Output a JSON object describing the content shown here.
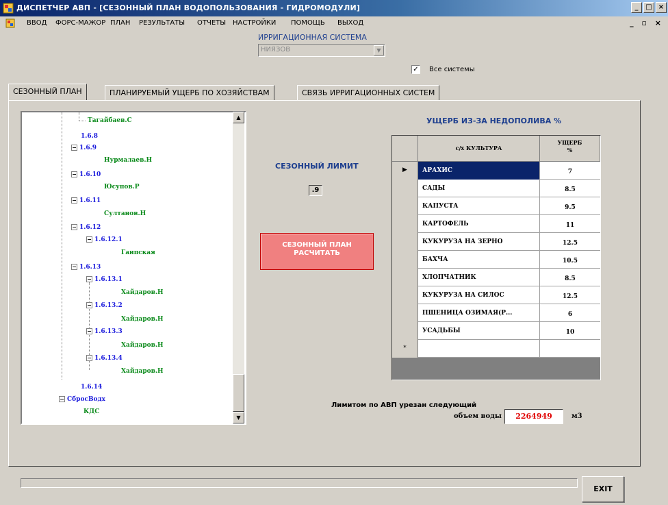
{
  "window": {
    "title": "ДИСПЕТЧЕР АВП - [СЕЗОННЫЙ ПЛАН ВОДОПОЛЬЗОВАНИЯ - ГИДРОМОДУЛИ]",
    "min": "_",
    "max": "□",
    "close": "×"
  },
  "menu": {
    "items": [
      "ВВОД",
      "ФОРС-МАЖОР",
      "ПЛАН",
      "РЕЗУЛЬТАТЫ",
      "ОТЧЕТЫ",
      "НАСТРОЙКИ",
      "ПОМОЩЬ",
      "ВЫХОД"
    ],
    "mdi_controls": "_ ▫ ×"
  },
  "system": {
    "label": "ИРРИГАЦИОННАЯ СИСТЕМА",
    "value": "НИЯЗОВ",
    "all_systems_label": "Все системы",
    "all_systems_checked": "✓"
  },
  "tabs": [
    "СЕЗОННЫЙ ПЛАН",
    "ПЛАНИРУЕМЫЙ УЩЕРБ ПО ХОЗЯЙСТВАМ",
    "СВЯЗЬ ИРРИГАЦИОННЫХ СИСТЕМ"
  ],
  "tree": {
    "nodes": [
      {
        "text": "Тагайбаев.С",
        "type": "leaf",
        "exp": ""
      },
      {
        "text": "1.6.8",
        "type": "num",
        "exp": ""
      },
      {
        "text": "1.6.9",
        "type": "num",
        "exp": "−"
      },
      {
        "text": "Нурмалаев.Н",
        "type": "leaf",
        "exp": ""
      },
      {
        "text": "1.6.10",
        "type": "num",
        "exp": "−"
      },
      {
        "text": "Юсупов.Р",
        "type": "leaf",
        "exp": ""
      },
      {
        "text": "1.6.11",
        "type": "num",
        "exp": "−"
      },
      {
        "text": "Султанов.Н",
        "type": "leaf",
        "exp": ""
      },
      {
        "text": "1.6.12",
        "type": "num",
        "exp": "−"
      },
      {
        "text": "1.6.12.1",
        "type": "num",
        "exp": "−"
      },
      {
        "text": "Гаипская",
        "type": "leaf",
        "exp": ""
      },
      {
        "text": "1.6.13",
        "type": "num",
        "exp": "−"
      },
      {
        "text": "1.6.13.1",
        "type": "num",
        "exp": "−"
      },
      {
        "text": "Хайдаров.Н",
        "type": "leaf",
        "exp": ""
      },
      {
        "text": "1.6.13.2",
        "type": "num",
        "exp": "−"
      },
      {
        "text": "Хайдаров.Н",
        "type": "leaf",
        "exp": ""
      },
      {
        "text": "1.6.13.3",
        "type": "num",
        "exp": "−"
      },
      {
        "text": "Хайдаров.Н",
        "type": "leaf",
        "exp": ""
      },
      {
        "text": "1.6.13.4",
        "type": "num",
        "exp": "−"
      },
      {
        "text": "Хайдаров.Н",
        "type": "leaf",
        "exp": ""
      },
      {
        "text": "1.6.14",
        "type": "num",
        "exp": ""
      },
      {
        "text": "СбросВодх",
        "type": "num",
        "exp": "−"
      },
      {
        "text": "КДС",
        "type": "leaf",
        "exp": ""
      }
    ],
    "scroll_up": "▲",
    "scroll_down": "▼"
  },
  "limit": {
    "label": "СЕЗОННЫЙ ЛИМИТ",
    "value": ".9"
  },
  "calc_button": {
    "line1": "СЕЗОННЫЙ ПЛАН",
    "line2": "РАСЧИТАТЬ"
  },
  "damage_table": {
    "title": "УЩЕРБ ИЗ-ЗА НЕДОПОЛИВА  %",
    "col_crop": "с/х КУЛЬТУРА",
    "col_damage": "УЩЕРБ\n%",
    "current_row_marker": "▶",
    "new_row_marker": "*",
    "rows": [
      {
        "crop": "АРАХИС",
        "damage": "7"
      },
      {
        "crop": "САДЫ",
        "damage": "8.5"
      },
      {
        "crop": "КАПУСТА",
        "damage": "9.5"
      },
      {
        "crop": "КАРТОФЕЛЬ",
        "damage": "11"
      },
      {
        "crop": "КУКУРУЗА НА ЗЕРНО",
        "damage": "12.5"
      },
      {
        "crop": "БАХЧА",
        "damage": "10.5"
      },
      {
        "crop": "ХЛОПЧАТНИК",
        "damage": "8.5"
      },
      {
        "crop": "КУКУРУЗА НА СИЛОС",
        "damage": "12.5"
      },
      {
        "crop": "ПШЕНИЦА ОЗИМАЯ(Р...",
        "damage": "6"
      },
      {
        "crop": "УСАДЬБЫ",
        "damage": "10"
      }
    ]
  },
  "cut_volume": {
    "label_line1": "Лимитом по АВП урезан следующий",
    "label_line2": "объем воды",
    "value": "2264949",
    "unit": "м3"
  },
  "progress": {
    "fraction": 0
  },
  "exit_button": "EXIT",
  "colors": {
    "accent_blue": "#1e3f8f",
    "tree_number": "#1a1adc",
    "tree_leaf": "#0a8a1a",
    "calc_button": "#f08080",
    "value_red": "#e00000",
    "selection": "#0a246a"
  }
}
